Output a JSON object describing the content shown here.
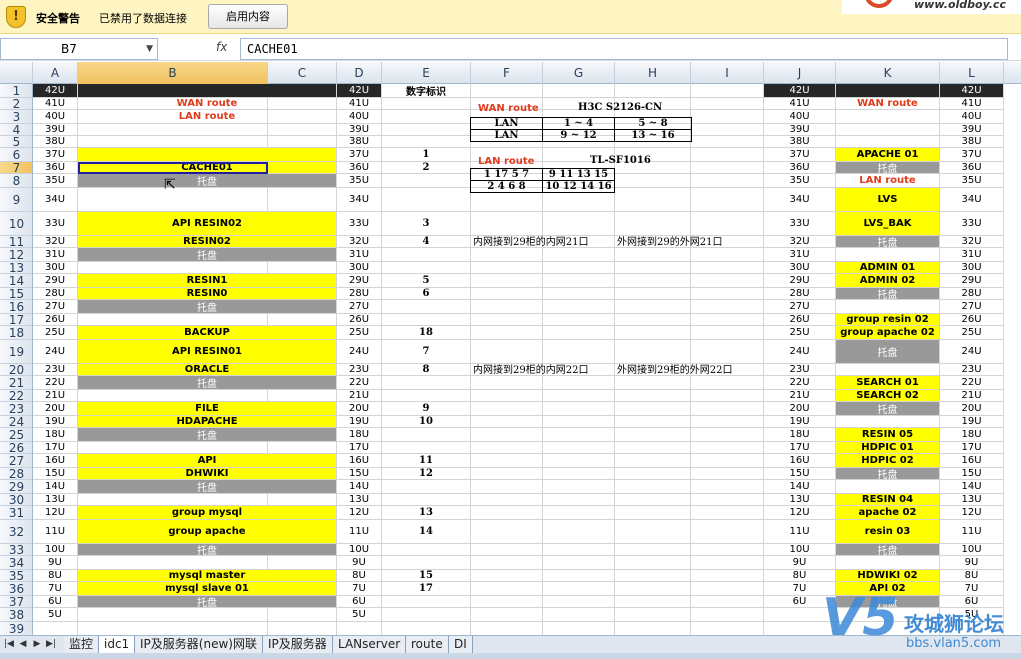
{
  "security_bar": {
    "title": "安全警告",
    "message": "已禁用了数据连接",
    "enable_button": "启用内容",
    "logo_text": "www.oldboy.cc"
  },
  "formula_bar": {
    "name_box": "B7",
    "fx_label": "fx",
    "content": "CACHE01"
  },
  "columns": [
    "A",
    "B",
    "C",
    "D",
    "E",
    "F",
    "G",
    "H",
    "I",
    "J",
    "K",
    "L"
  ],
  "selected_column": "B",
  "rows": [
    "1",
    "2",
    "3",
    "4",
    "5",
    "6",
    "7",
    "8",
    "9",
    "10",
    "11",
    "12",
    "13",
    "14",
    "15",
    "16",
    "17",
    "18",
    "19",
    "20",
    "21",
    "22",
    "23",
    "24",
    "25",
    "26",
    "27",
    "28",
    "29",
    "30",
    "31",
    "32",
    "33",
    "34",
    "35",
    "36",
    "37",
    "38",
    "39"
  ],
  "selected_row": "7",
  "units_a": [
    "42U",
    "41U",
    "40U",
    "39U",
    "38U",
    "37U",
    "36U",
    "35U",
    "34U",
    "33U",
    "32U",
    "31U",
    "30U",
    "29U",
    "28U",
    "27U",
    "26U",
    "25U",
    "24U",
    "23U",
    "22U",
    "21U",
    "20U",
    "19U",
    "18U",
    "17U",
    "16U",
    "15U",
    "14U",
    "13U",
    "12U",
    "11U",
    "10U",
    "9U",
    "8U",
    "7U",
    "6U",
    "5U"
  ],
  "units_d": [
    "42U",
    "41U",
    "40U",
    "39U",
    "38U",
    "37U",
    "36U",
    "35U",
    "34U",
    "33U",
    "32U",
    "31U",
    "30U",
    "29U",
    "28U",
    "27U",
    "26U",
    "25U",
    "24U",
    "23U",
    "22U",
    "21U",
    "20U",
    "19U",
    "18U",
    "17U",
    "16U",
    "15U",
    "14U",
    "13U",
    "12U",
    "11U",
    "10U",
    "9U",
    "8U",
    "7U",
    "6U",
    "5U"
  ],
  "units_j": [
    "42U",
    "41U",
    "40U",
    "39U",
    "38U",
    "37U",
    "36U",
    "35U",
    "34U",
    "33U",
    "32U",
    "31U",
    "30U",
    "29U",
    "28U",
    "27U",
    "26U",
    "25U",
    "24U",
    "23U",
    "22U",
    "21U",
    "20U",
    "19U",
    "18U",
    "17U",
    "16U",
    "15U",
    "14U",
    "13U",
    "12U",
    "11U",
    "10U",
    "9U",
    "8U",
    "7U",
    "6U"
  ],
  "units_l": [
    "42U",
    "41U",
    "40U",
    "39U",
    "38U",
    "37U",
    "36U",
    "35U",
    "34U",
    "33U",
    "32U",
    "31U",
    "30U",
    "29U",
    "28U",
    "27U",
    "26U",
    "25U",
    "24U",
    "23U",
    "22U",
    "21U",
    "20U",
    "19U",
    "18U",
    "17U",
    "16U",
    "15U",
    "14U",
    "13U",
    "12U",
    "11U",
    "10U",
    "9U",
    "8U",
    "7U",
    "6U",
    "5U"
  ],
  "rack_b": {
    "wan_route": "WAN route",
    "lan_route": "LAN route",
    "cache01": "CACHE01",
    "tray": "托盘",
    "api_resin02": "API RESIN02",
    "resin02": "RESIN02",
    "resin1": "RESIN1",
    "resin0": "RESIN0",
    "backup": "BACKUP",
    "api_resin01": "API RESIN01",
    "oracle": "ORACLE",
    "file": "FILE",
    "hdapache": "HDAPACHE",
    "api": "API",
    "dhwiki": "DHWIKI",
    "group_mysql": "group mysql",
    "group_apache": "group  apache",
    "mysql_master": "mysql master",
    "mysql_slave": "mysql slave 01"
  },
  "rack_k": {
    "wan_route": "WAN route",
    "apache01": "APACHE 01",
    "tray": "托盘",
    "lan_route": "LAN route",
    "lvs": "LVS",
    "lvs_bak": "LVS_BAK",
    "admin01": "ADMIN 01",
    "admin02": "ADMIN 02",
    "group_resin02": "group resin 02",
    "group_apache02": "group apache 02",
    "search01": "SEARCH 01",
    "search02": "SEARCH 02",
    "resin05": "RESIN 05",
    "hdpic01": "HDPIC 01",
    "hdpic02": "HDPIC 02",
    "resin04": "RESIN 04",
    "apache02": "apache 02",
    "resin03": "resin 03",
    "hdwiki02": "HDWIKI 02",
    "api02": "API 02"
  },
  "column_e": {
    "header": "数字标识",
    "nums": [
      "1",
      "2",
      "3",
      "4",
      "5",
      "6",
      "18",
      "7",
      "8",
      "9",
      "10",
      "11",
      "12",
      "13",
      "14",
      "15",
      "17"
    ]
  },
  "switch_h3c": {
    "wan": "WAN route",
    "model": "H3C S2126-CN",
    "lan1": "LAN",
    "lan2": "LAN",
    "p1": "1 ~ 4",
    "p2": "5 ~ 8",
    "p3": "9 ~ 12",
    "p4": "13 ~ 16"
  },
  "switch_tl": {
    "lan": "LAN route",
    "model": "TL-SF1016",
    "p1": "1 17 5 7",
    "p2": "9 11 13 15",
    "p3": "2 4 6 8",
    "p4": "10 12 14 16"
  },
  "notes": {
    "n1a": "内网接到29柜的内网21口",
    "n1b": "外网接到29的外网21口",
    "n2a": "内网接到29柜的内网22口",
    "n2b": "外网接到29柜的外网22口"
  },
  "sheet_tabs": [
    "监控",
    "idc1",
    "IP及服务器(new)网联",
    "IP及服务器",
    "LANserver",
    "route",
    "DI"
  ],
  "active_tab": "idc1",
  "watermark": {
    "brand": "V5",
    "name": "攻城狮论坛",
    "url": "bbs.vlan5.com"
  }
}
